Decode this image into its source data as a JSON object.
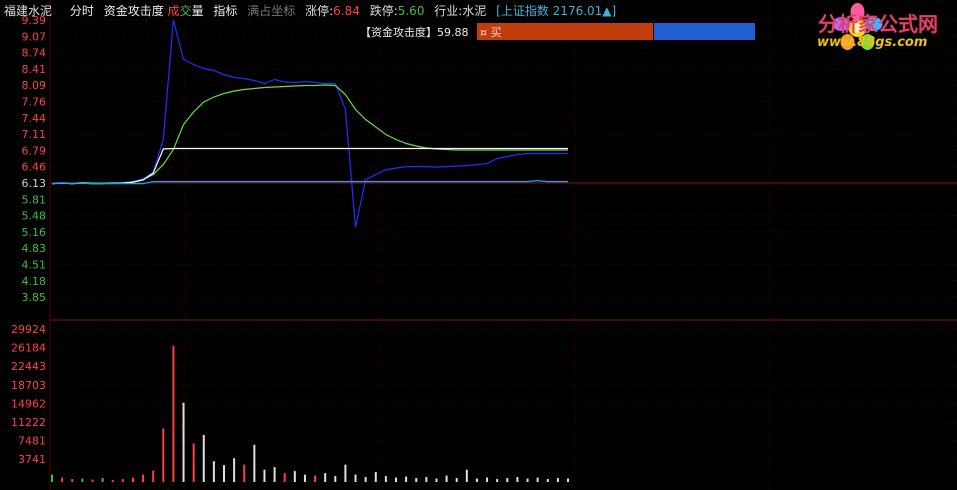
{
  "header": {
    "stock_name": "福建水泥",
    "tab_intraday": "分时",
    "indicator_name": "资金攻击度",
    "volume_prefix": "成",
    "volume_mid": "交",
    "volume_suffix": "量",
    "index_button": "指标",
    "overlay_coords": "满占坐标",
    "limit_up_label": "涨停:",
    "limit_up_value": "6.84",
    "limit_down_label": "跌停:",
    "limit_down_value": "5.60",
    "industry_label": "行业:",
    "industry_value": "水泥",
    "market_index": "[上证指数 2176.01▲]"
  },
  "indicator_panel": {
    "label": "【资金攻击度】",
    "value": "59.88",
    "bar_text": "¤ 买",
    "red_fraction": 0.6
  },
  "logo": {
    "title": "分析家公式网",
    "url": "www.88gs.com"
  },
  "footer_text": "",
  "colors": {
    "up": "#ff4040",
    "down": "#3fbf3f",
    "grid_red": "#5a0000",
    "avg_line": "#ffffff",
    "price_line": "#00b0ff",
    "indicator_blue": "#2030ff",
    "indicator_green": "#66dd44"
  },
  "chart_data": {
    "type": "line",
    "price_axis": {
      "ticks": [
        "9.39",
        "9.07",
        "8.74",
        "8.41",
        "8.09",
        "7.76",
        "7.44",
        "7.11",
        "6.79",
        "6.46",
        "6.13",
        "5.81",
        "5.48",
        "5.16",
        "4.83",
        "4.51",
        "4.18",
        "3.85"
      ],
      "tick_colors": [
        "up",
        "up",
        "up",
        "up",
        "up",
        "up",
        "up",
        "up",
        "up",
        "up",
        "neutral",
        "down",
        "down",
        "down",
        "down",
        "down",
        "down",
        "down"
      ],
      "ylim": [
        3.85,
        9.39
      ]
    },
    "volume_axis": {
      "ticks": [
        "29924",
        "26184",
        "22443",
        "18703",
        "14962",
        "11222",
        "7481",
        "3741"
      ],
      "ylim": [
        0,
        29924
      ]
    },
    "series": [
      {
        "name": "资金攻击度",
        "color": "indicator_blue",
        "values": [
          6.12,
          6.14,
          6.12,
          6.13,
          6.12,
          6.12,
          6.12,
          6.14,
          6.16,
          6.22,
          6.35,
          7.0,
          9.39,
          8.6,
          8.5,
          8.42,
          8.38,
          8.3,
          8.24,
          8.22,
          8.18,
          8.12,
          8.2,
          8.15,
          8.14,
          8.16,
          8.14,
          8.12,
          8.12,
          7.6,
          5.25,
          6.2,
          6.3,
          6.4,
          6.43,
          6.46,
          6.46,
          6.46,
          6.45,
          6.46,
          6.47,
          6.48,
          6.5,
          6.52,
          6.62,
          6.66,
          6.7,
          6.72,
          6.72,
          6.72,
          6.72,
          6.72
        ]
      },
      {
        "name": "资金攻击度2",
        "color": "indicator_green",
        "values": [
          6.12,
          6.13,
          6.12,
          6.14,
          6.13,
          6.13,
          6.13,
          6.13,
          6.15,
          6.2,
          6.3,
          6.5,
          6.8,
          7.3,
          7.55,
          7.75,
          7.85,
          7.92,
          7.97,
          8.0,
          8.02,
          8.04,
          8.05,
          8.06,
          8.07,
          8.08,
          8.08,
          8.09,
          8.08,
          7.9,
          7.6,
          7.4,
          7.25,
          7.1,
          7.0,
          6.92,
          6.87,
          6.83,
          6.81,
          6.8,
          6.79,
          6.79,
          6.79,
          6.79,
          6.79,
          6.79,
          6.79,
          6.79,
          6.79,
          6.79,
          6.79,
          6.79
        ]
      },
      {
        "name": "均价",
        "color": "avg_line",
        "values": [
          6.12,
          6.13,
          6.12,
          6.13,
          6.12,
          6.12,
          6.13,
          6.13,
          6.15,
          6.19,
          6.33,
          6.81,
          6.82,
          6.82,
          6.82,
          6.82,
          6.82,
          6.82,
          6.82,
          6.82,
          6.82,
          6.82,
          6.82,
          6.82,
          6.82,
          6.82,
          6.82,
          6.82,
          6.82,
          6.82,
          6.82,
          6.82,
          6.82,
          6.82,
          6.82,
          6.82,
          6.82,
          6.82,
          6.82,
          6.82,
          6.82,
          6.82,
          6.82,
          6.82,
          6.82,
          6.82,
          6.82,
          6.82,
          6.82,
          6.82,
          6.82,
          6.82
        ]
      },
      {
        "name": "价格",
        "color": "price_line",
        "values": [
          6.12,
          6.13,
          6.12,
          6.13,
          6.12,
          6.12,
          6.12,
          6.12,
          6.12,
          6.12,
          6.16,
          6.16,
          6.16,
          6.16,
          6.16,
          6.16,
          6.16,
          6.16,
          6.16,
          6.16,
          6.16,
          6.16,
          6.16,
          6.16,
          6.16,
          6.16,
          6.16,
          6.16,
          6.16,
          6.16,
          6.16,
          6.16,
          6.16,
          6.16,
          6.16,
          6.16,
          6.16,
          6.16,
          6.16,
          6.16,
          6.16,
          6.16,
          6.16,
          6.16,
          6.16,
          6.16,
          6.16,
          6.16,
          6.18,
          6.16,
          6.16,
          6.16
        ]
      }
    ],
    "volume": [
      {
        "v": 1500,
        "c": "down"
      },
      {
        "v": 900,
        "c": "up"
      },
      {
        "v": 600,
        "c": "up"
      },
      {
        "v": 700,
        "c": "down"
      },
      {
        "v": 500,
        "c": "up"
      },
      {
        "v": 800,
        "c": "down"
      },
      {
        "v": 400,
        "c": "up"
      },
      {
        "v": 600,
        "c": "up"
      },
      {
        "v": 900,
        "c": "up"
      },
      {
        "v": 1500,
        "c": "up"
      },
      {
        "v": 2300,
        "c": "up"
      },
      {
        "v": 10800,
        "c": "up"
      },
      {
        "v": 27500,
        "c": "up"
      },
      {
        "v": 16000,
        "c": "neutral"
      },
      {
        "v": 7800,
        "c": "up"
      },
      {
        "v": 9500,
        "c": "neutral"
      },
      {
        "v": 4200,
        "c": "neutral"
      },
      {
        "v": 3400,
        "c": "neutral"
      },
      {
        "v": 4800,
        "c": "neutral"
      },
      {
        "v": 3500,
        "c": "up"
      },
      {
        "v": 7500,
        "c": "neutral"
      },
      {
        "v": 2500,
        "c": "neutral"
      },
      {
        "v": 3000,
        "c": "neutral"
      },
      {
        "v": 1800,
        "c": "up"
      },
      {
        "v": 2200,
        "c": "neutral"
      },
      {
        "v": 1500,
        "c": "neutral"
      },
      {
        "v": 1300,
        "c": "up"
      },
      {
        "v": 1800,
        "c": "neutral"
      },
      {
        "v": 1200,
        "c": "neutral"
      },
      {
        "v": 3500,
        "c": "neutral"
      },
      {
        "v": 1500,
        "c": "neutral"
      },
      {
        "v": 1000,
        "c": "neutral"
      },
      {
        "v": 2000,
        "c": "neutral"
      },
      {
        "v": 1200,
        "c": "neutral"
      },
      {
        "v": 900,
        "c": "neutral"
      },
      {
        "v": 1100,
        "c": "neutral"
      },
      {
        "v": 800,
        "c": "neutral"
      },
      {
        "v": 1000,
        "c": "neutral"
      },
      {
        "v": 700,
        "c": "neutral"
      },
      {
        "v": 1300,
        "c": "neutral"
      },
      {
        "v": 800,
        "c": "neutral"
      },
      {
        "v": 2500,
        "c": "neutral"
      },
      {
        "v": 700,
        "c": "neutral"
      },
      {
        "v": 900,
        "c": "neutral"
      },
      {
        "v": 600,
        "c": "neutral"
      },
      {
        "v": 800,
        "c": "neutral"
      },
      {
        "v": 1000,
        "c": "neutral"
      },
      {
        "v": 700,
        "c": "neutral"
      },
      {
        "v": 900,
        "c": "neutral"
      },
      {
        "v": 600,
        "c": "neutral"
      },
      {
        "v": 800,
        "c": "neutral"
      },
      {
        "v": 700,
        "c": "neutral"
      }
    ]
  }
}
